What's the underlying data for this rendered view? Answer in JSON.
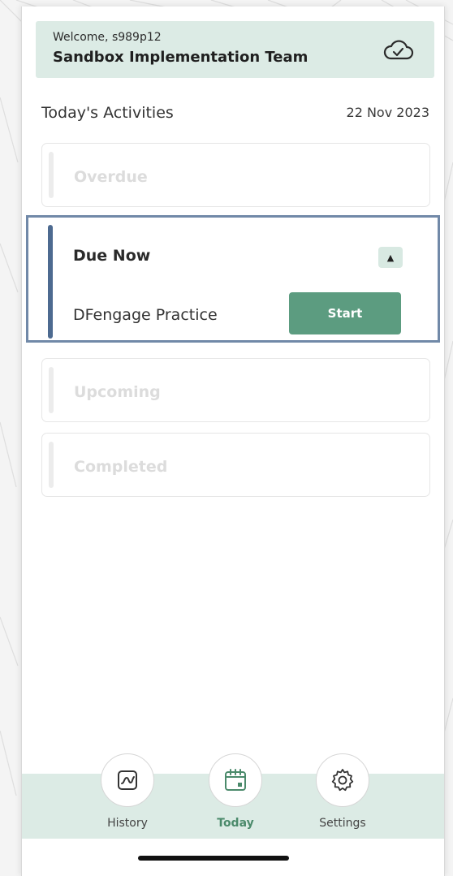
{
  "header": {
    "welcome": "Welcome, s989p12",
    "team": "Sandbox Implementation Team",
    "sync_icon": "cloud-check-icon"
  },
  "activities": {
    "title": "Today's Activities",
    "date": "22 Nov 2023",
    "overdue_label": "Overdue",
    "due_now_label": "Due Now",
    "due_now_items": [
      {
        "name": "DFengage Practice",
        "action": "Start"
      }
    ],
    "upcoming_label": "Upcoming",
    "completed_label": "Completed"
  },
  "nav": {
    "items": [
      {
        "label": "History",
        "icon": "trend-chart-icon",
        "active": false
      },
      {
        "label": "Today",
        "icon": "calendar-icon",
        "active": true
      },
      {
        "label": "Settings",
        "icon": "gear-icon",
        "active": false
      }
    ]
  },
  "colors": {
    "accent_green": "#5c9c80",
    "header_bg": "#dcebe5",
    "due_bar": "#4d6a90",
    "focus_frame": "#7189a8"
  }
}
